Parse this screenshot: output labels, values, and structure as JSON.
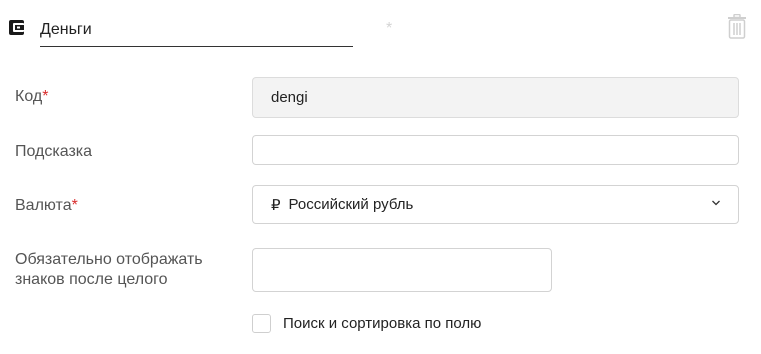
{
  "header": {
    "name_value": "Деньги",
    "required_marker": "*",
    "icons": {
      "leading": "wallet-icon",
      "delete": "trash-icon"
    }
  },
  "fields": {
    "code": {
      "label": "Код",
      "required": "*",
      "value": "dengi"
    },
    "hint": {
      "label": "Подсказка",
      "value": ""
    },
    "currency": {
      "label": "Валюта",
      "required": "*",
      "symbol": "₽",
      "value": "Российский рубль",
      "icon": "chevron-down-icon"
    },
    "decimals": {
      "label_line1": "Обязательно отображать",
      "label_line2": "знаков после целого",
      "value": ""
    }
  },
  "search_sort": {
    "label": "Поиск и сортировка по полю",
    "checked": false
  },
  "colors": {
    "required": "#d92b2b",
    "border": "#d3d3d3",
    "readonly_bg": "#f3f3f3"
  }
}
